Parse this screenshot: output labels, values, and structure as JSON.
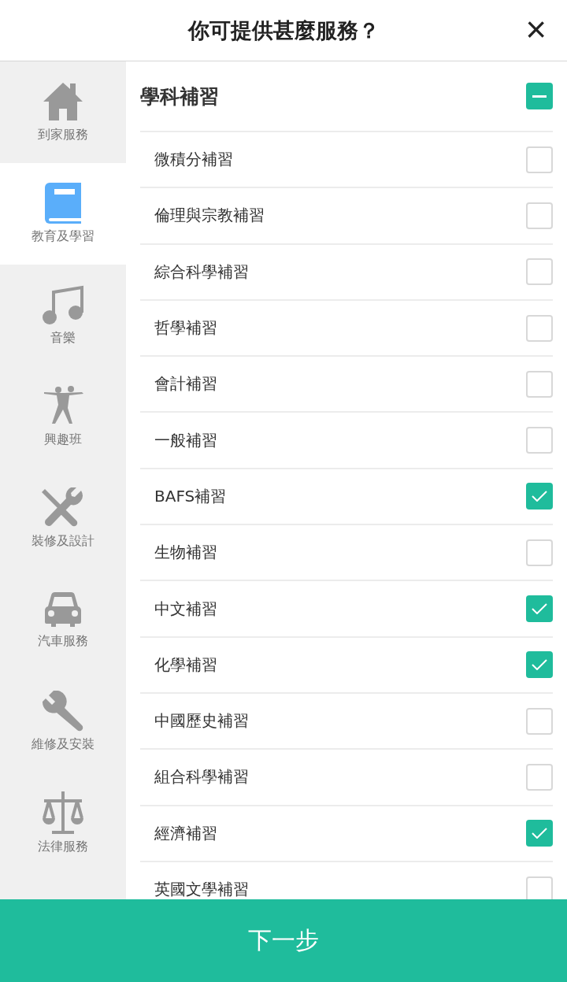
{
  "header": {
    "title": "你可提供甚麼服務？",
    "close": "×"
  },
  "sidebar": {
    "items": [
      {
        "kind": "home",
        "label": "到家服務",
        "selected": false
      },
      {
        "kind": "book",
        "label": "教育及學習",
        "selected": true
      },
      {
        "kind": "music",
        "label": "音樂",
        "selected": false
      },
      {
        "kind": "dance",
        "label": "興趣班",
        "selected": false
      },
      {
        "kind": "tools",
        "label": "裝修及設計",
        "selected": false
      },
      {
        "kind": "car",
        "label": "汽車服務",
        "selected": false
      },
      {
        "kind": "wrench",
        "label": "維修及安裝",
        "selected": false
      },
      {
        "kind": "scale",
        "label": "法律服務",
        "selected": false
      }
    ]
  },
  "category": {
    "title": "學科補習",
    "partial": true,
    "items": [
      {
        "label": "微積分補習",
        "checked": false
      },
      {
        "label": "倫理與宗教補習",
        "checked": false
      },
      {
        "label": "綜合科學補習",
        "checked": false
      },
      {
        "label": "哲學補習",
        "checked": false
      },
      {
        "label": "會計補習",
        "checked": false
      },
      {
        "label": "一般補習",
        "checked": false
      },
      {
        "label": "BAFS補習",
        "checked": true
      },
      {
        "label": "生物補習",
        "checked": false
      },
      {
        "label": "中文補習",
        "checked": true
      },
      {
        "label": "化學補習",
        "checked": true
      },
      {
        "label": "中國歷史補習",
        "checked": false
      },
      {
        "label": "組合科學補習",
        "checked": false
      },
      {
        "label": "經濟補習",
        "checked": true
      },
      {
        "label": "英國文學補習",
        "checked": false
      }
    ]
  },
  "footer": {
    "button": "下一步"
  }
}
